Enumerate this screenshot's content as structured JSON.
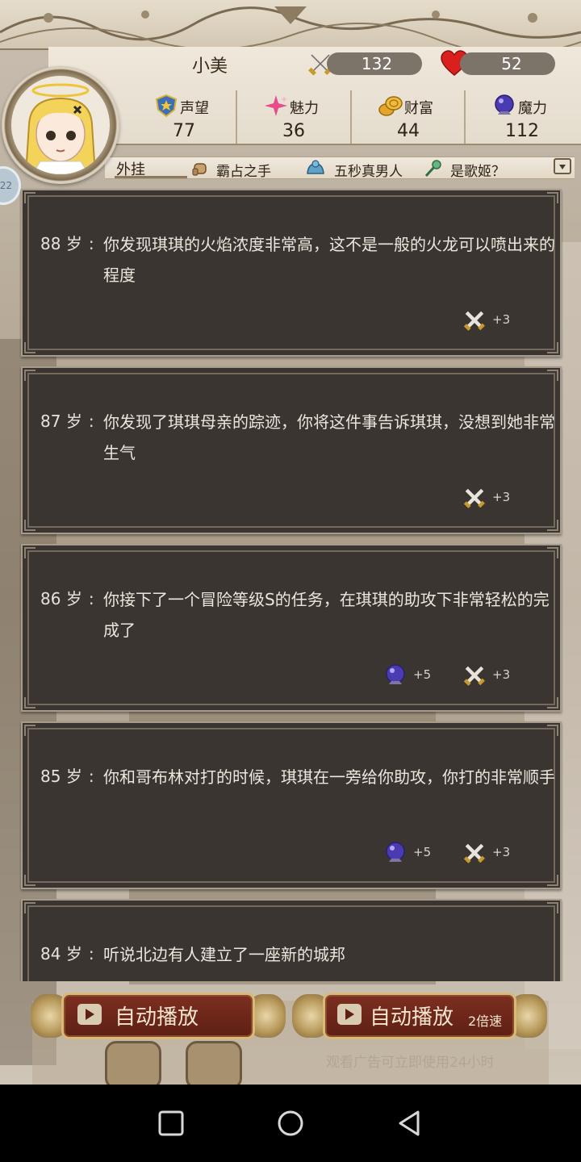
{
  "player": {
    "name": "小美",
    "attack": "132",
    "health": "52",
    "side_badge": "22"
  },
  "stats": [
    {
      "label": "声望",
      "value": "77",
      "icon": "shield-star-icon"
    },
    {
      "label": "魅力",
      "value": "36",
      "icon": "sparkle-icon"
    },
    {
      "label": "财富",
      "value": "44",
      "icon": "coins-icon"
    },
    {
      "label": "魔力",
      "value": "112",
      "icon": "magic-orb-icon"
    }
  ],
  "cheats": {
    "label": "外挂",
    "items": [
      "霸占之手",
      "五秒真男人",
      "是歌姬？"
    ]
  },
  "events": [
    {
      "age": "88",
      "unit": "岁",
      "sep": ":",
      "text": "你发现琪琪的火焰浓度非常高，这不是一般的火龙可以喷出来的程度",
      "rewards": [
        {
          "icon": "sword-icon",
          "value": "+3"
        }
      ]
    },
    {
      "age": "87",
      "unit": "岁",
      "sep": ":",
      "text": "你发现了琪琪母亲的踪迹，你将这件事告诉琪琪，没想到她非常生气",
      "rewards": [
        {
          "icon": "sword-icon",
          "value": "+3"
        }
      ]
    },
    {
      "age": "86",
      "unit": "岁",
      "sep": ":",
      "text": "你接下了一个冒险等级S的任务，在琪琪的助攻下非常轻松的完成了",
      "rewards": [
        {
          "icon": "magic-orb-icon",
          "value": "+5"
        },
        {
          "icon": "sword-icon",
          "value": "+3"
        }
      ]
    },
    {
      "age": "85",
      "unit": "岁",
      "sep": ":",
      "text": "你和哥布林对打的时候，琪琪在一旁给你助攻，你打的非常顺手",
      "rewards": [
        {
          "icon": "magic-orb-icon",
          "value": "+5"
        },
        {
          "icon": "sword-icon",
          "value": "+3"
        }
      ]
    },
    {
      "age": "84",
      "unit": "岁",
      "sep": ":",
      "text": "听说北边有人建立了一座新的城邦",
      "rewards": []
    }
  ],
  "buttons": {
    "auto_play": "自动播放",
    "auto_play_fast": "自动播放",
    "speed": "2倍速",
    "ad_note": "观看广告可立即使用24小时"
  },
  "colors": {
    "card_bg": "#3b3531",
    "button_bg": "#7d2f20",
    "accent_gold": "#d8b978"
  }
}
